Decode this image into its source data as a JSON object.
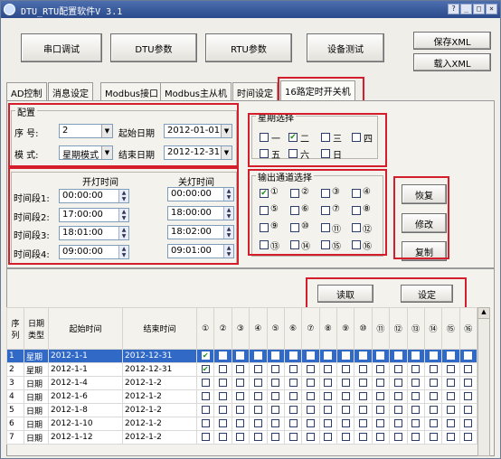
{
  "window": {
    "title": "DTU_RTU配置软件V 3.1",
    "controls": [
      "?",
      "_",
      "□",
      "×"
    ]
  },
  "toolbar": {
    "serial_debug": "串口调试",
    "dtu_params": "DTU参数",
    "rtu_params": "RTU参数",
    "device_test": "设备测试",
    "save_xml": "保存XML",
    "load_xml": "载入XML"
  },
  "tabs": [
    "AD控制",
    "消息设定",
    "Modbus接口",
    "Modbus主从机",
    "时间设定",
    "16路定时开关机"
  ],
  "config": {
    "title": "配置",
    "seq_label": "序  号:",
    "seq_value": "2",
    "mode_label": "模  式:",
    "mode_value": "星期模式",
    "start_date_label": "起始日期",
    "start_date_value": "2012-01-01",
    "end_date_label": "结束日期",
    "end_date_value": "2012-12-31"
  },
  "times": {
    "on_header": "开灯时间",
    "off_header": "关灯时间",
    "rows": [
      {
        "label": "时间段1:",
        "on": "00:00:00",
        "off": "00:00:00"
      },
      {
        "label": "时间段2:",
        "on": "17:00:00",
        "off": "18:00:00"
      },
      {
        "label": "时间段3:",
        "on": "18:01:00",
        "off": "18:02:00"
      },
      {
        "label": "时间段4:",
        "on": "09:00:00",
        "off": "09:01:00"
      }
    ]
  },
  "week": {
    "title": "星期选择",
    "days": [
      {
        "label": "一",
        "checked": false
      },
      {
        "label": "二",
        "checked": true
      },
      {
        "label": "三",
        "checked": false
      },
      {
        "label": "四",
        "checked": false
      },
      {
        "label": "五",
        "checked": false
      },
      {
        "label": "六",
        "checked": false
      },
      {
        "label": "日",
        "checked": false
      }
    ]
  },
  "channels": {
    "title": "输出通道选择",
    "items": [
      "①",
      "②",
      "③",
      "④",
      "⑤",
      "⑥",
      "⑦",
      "⑧",
      "⑨",
      "⑩",
      "⑪",
      "⑫",
      "⑬",
      "⑭",
      "⑮",
      "⑯"
    ],
    "checked": [
      true,
      false,
      false,
      false,
      false,
      false,
      false,
      false,
      false,
      false,
      false,
      false,
      false,
      false,
      false,
      false
    ]
  },
  "actions": {
    "restore": "恢复",
    "modify": "修改",
    "copy": "复制",
    "read": "读取",
    "set": "设定"
  },
  "table": {
    "headers": {
      "seq": "序列",
      "type": "日期类型",
      "start": "起始时间",
      "end": "结束时间"
    },
    "channel_headers": [
      "①",
      "②",
      "③",
      "④",
      "⑤",
      "⑥",
      "⑦",
      "⑧",
      "⑨",
      "⑩",
      "⑪",
      "⑫",
      "⑬",
      "⑭",
      "⑮",
      "⑯"
    ],
    "rows": [
      {
        "seq": "1",
        "type": "星期",
        "start": "2012-1-1",
        "end": "2012-12-31",
        "ch1": true,
        "selected": true
      },
      {
        "seq": "2",
        "type": "星期",
        "start": "2012-1-1",
        "end": "2012-12-31",
        "ch1": true,
        "selected": false
      },
      {
        "seq": "3",
        "type": "日期",
        "start": "2012-1-4",
        "end": "2012-1-2",
        "ch1": false,
        "selected": false
      },
      {
        "seq": "4",
        "type": "日期",
        "start": "2012-1-6",
        "end": "2012-1-2",
        "ch1": false,
        "selected": false
      },
      {
        "seq": "5",
        "type": "日期",
        "start": "2012-1-8",
        "end": "2012-1-2",
        "ch1": false,
        "selected": false
      },
      {
        "seq": "6",
        "type": "日期",
        "start": "2012-1-10",
        "end": "2012-1-2",
        "ch1": false,
        "selected": false
      },
      {
        "seq": "7",
        "type": "日期",
        "start": "2012-1-12",
        "end": "2012-1-2",
        "ch1": false,
        "selected": false
      }
    ]
  },
  "colors": {
    "highlight_box": "#d51e2b",
    "selected_row": "#3169c6",
    "titlebar": "#2a4a8b"
  }
}
